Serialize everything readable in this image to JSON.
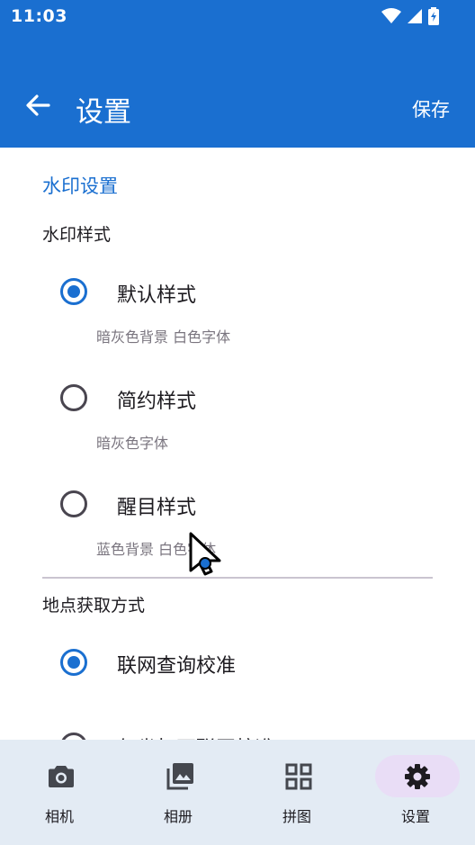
{
  "status_bar": {
    "time": "11:03"
  },
  "app_bar": {
    "title": "设置",
    "save_label": "保存"
  },
  "watermark": {
    "section_title": "水印设置",
    "style_label": "水印样式",
    "styles": [
      {
        "label": "默认样式",
        "desc": "暗灰色背景 白色字体",
        "checked": true
      },
      {
        "label": "简约样式",
        "desc": "暗灰色字体",
        "checked": false
      },
      {
        "label": "醒目样式",
        "desc": "蓝色背景 白色字体",
        "checked": false
      }
    ]
  },
  "location": {
    "label": "地点获取方式",
    "options": [
      {
        "label": "联网查询校准",
        "checked": true
      },
      {
        "label": "仅坐标不联网校准",
        "checked": false
      }
    ]
  },
  "bottom_nav": {
    "items": [
      {
        "label": "相机",
        "icon": "camera-icon",
        "active": false
      },
      {
        "label": "相册",
        "icon": "gallery-icon",
        "active": false
      },
      {
        "label": "拼图",
        "icon": "grid-icon",
        "active": false
      },
      {
        "label": "设置",
        "icon": "gear-icon",
        "active": true
      }
    ]
  },
  "colors": {
    "primary": "#1a6fd0",
    "nav_bg": "#e3ebf4",
    "active_pill": "#e9ddf6"
  }
}
